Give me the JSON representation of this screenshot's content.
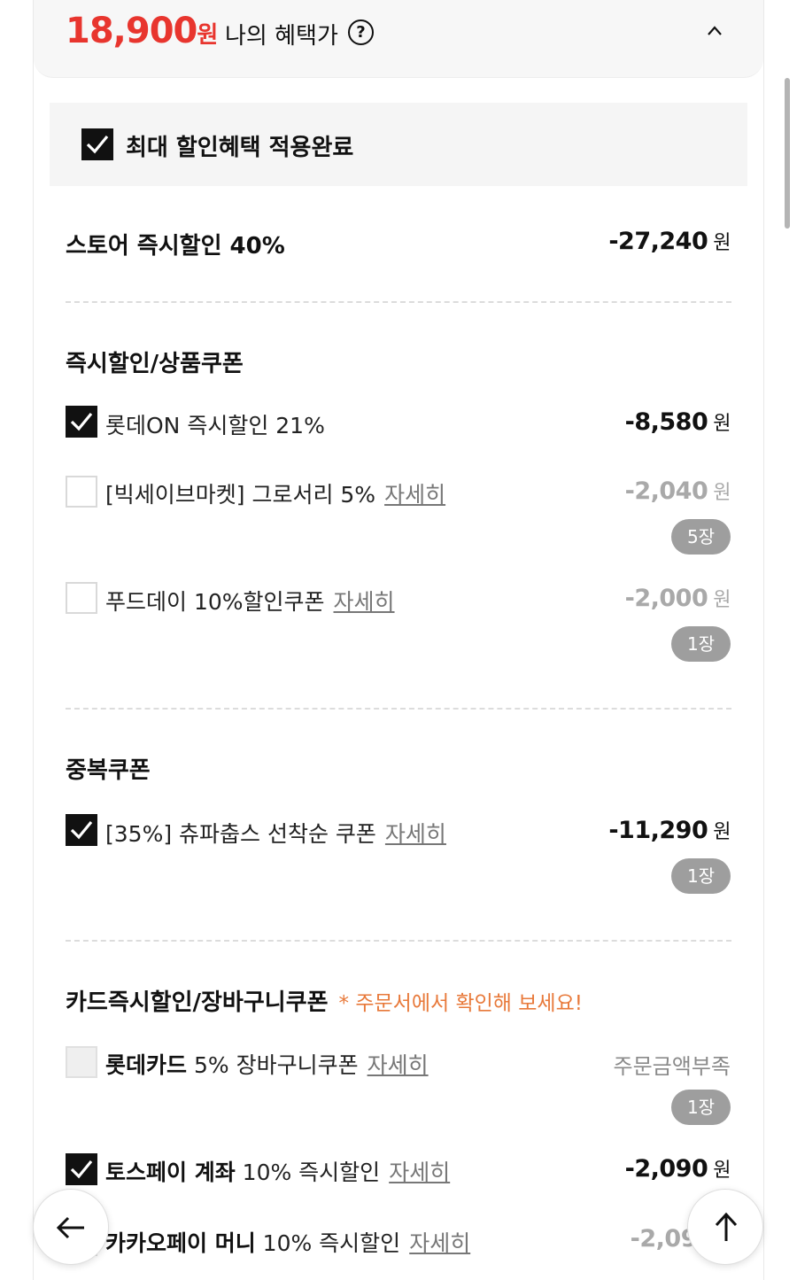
{
  "price_bar": {
    "amount": "18,900",
    "unit": "원",
    "label": "나의 혜택가",
    "help_icon": "?"
  },
  "max_benefit": {
    "label": "최대 할인혜택 적용완료",
    "checked": true
  },
  "store_discount": {
    "label": "스토어 즉시할인 40%",
    "amount": "-27,240",
    "won": "원"
  },
  "section_instant": {
    "title": "즉시할인/상품쿠폰",
    "items": [
      {
        "label": "롯데ON 즉시할인 21%",
        "amount": "-8,580",
        "won": "원",
        "checked": true
      },
      {
        "label": "[빅세이브마켓] 그로서리 5%",
        "link": "자세히",
        "amount": "-2,040",
        "won": "원",
        "badge": "5장",
        "checked": false
      },
      {
        "label": "푸드데이 10%할인쿠폰",
        "link": "자세히",
        "amount": "-2,000",
        "won": "원",
        "badge": "1장",
        "checked": false
      }
    ]
  },
  "section_duplicate": {
    "title": "중복쿠폰",
    "items": [
      {
        "label": "[35%] 츄파춥스 선착순 쿠폰",
        "link": "자세히",
        "amount": "-11,290",
        "won": "원",
        "badge": "1장",
        "checked": true
      }
    ]
  },
  "section_card": {
    "title": "카드즉시할인/장바구니쿠폰",
    "note": "* 주문서에서 확인해 보세요!",
    "items": [
      {
        "bold": "롯데카드",
        "label": " 5% 장바구니쿠폰",
        "link": "자세히",
        "status": "주문금액부족",
        "badge": "1장",
        "checked": false,
        "disabled": true
      },
      {
        "bold": "토스페이 계좌",
        "label": " 10% 즉시할인",
        "link": "자세히",
        "amount": "-2,090",
        "won": "원",
        "checked": true
      },
      {
        "bold": "카카오페이 머니",
        "label": " 10% 즉시할인",
        "link": "자세히",
        "amount": "-2,09",
        "checked": false
      }
    ]
  },
  "icons": {
    "back": "arrow-left-icon",
    "top": "arrow-up-icon",
    "collapse": "chevron-up-icon",
    "check": "checkmark-icon"
  },
  "colors": {
    "price_red": "#e8352e",
    "note_orange": "#e8793a",
    "badge_gray": "#9e9e9e",
    "checkbox_black": "#111111"
  }
}
